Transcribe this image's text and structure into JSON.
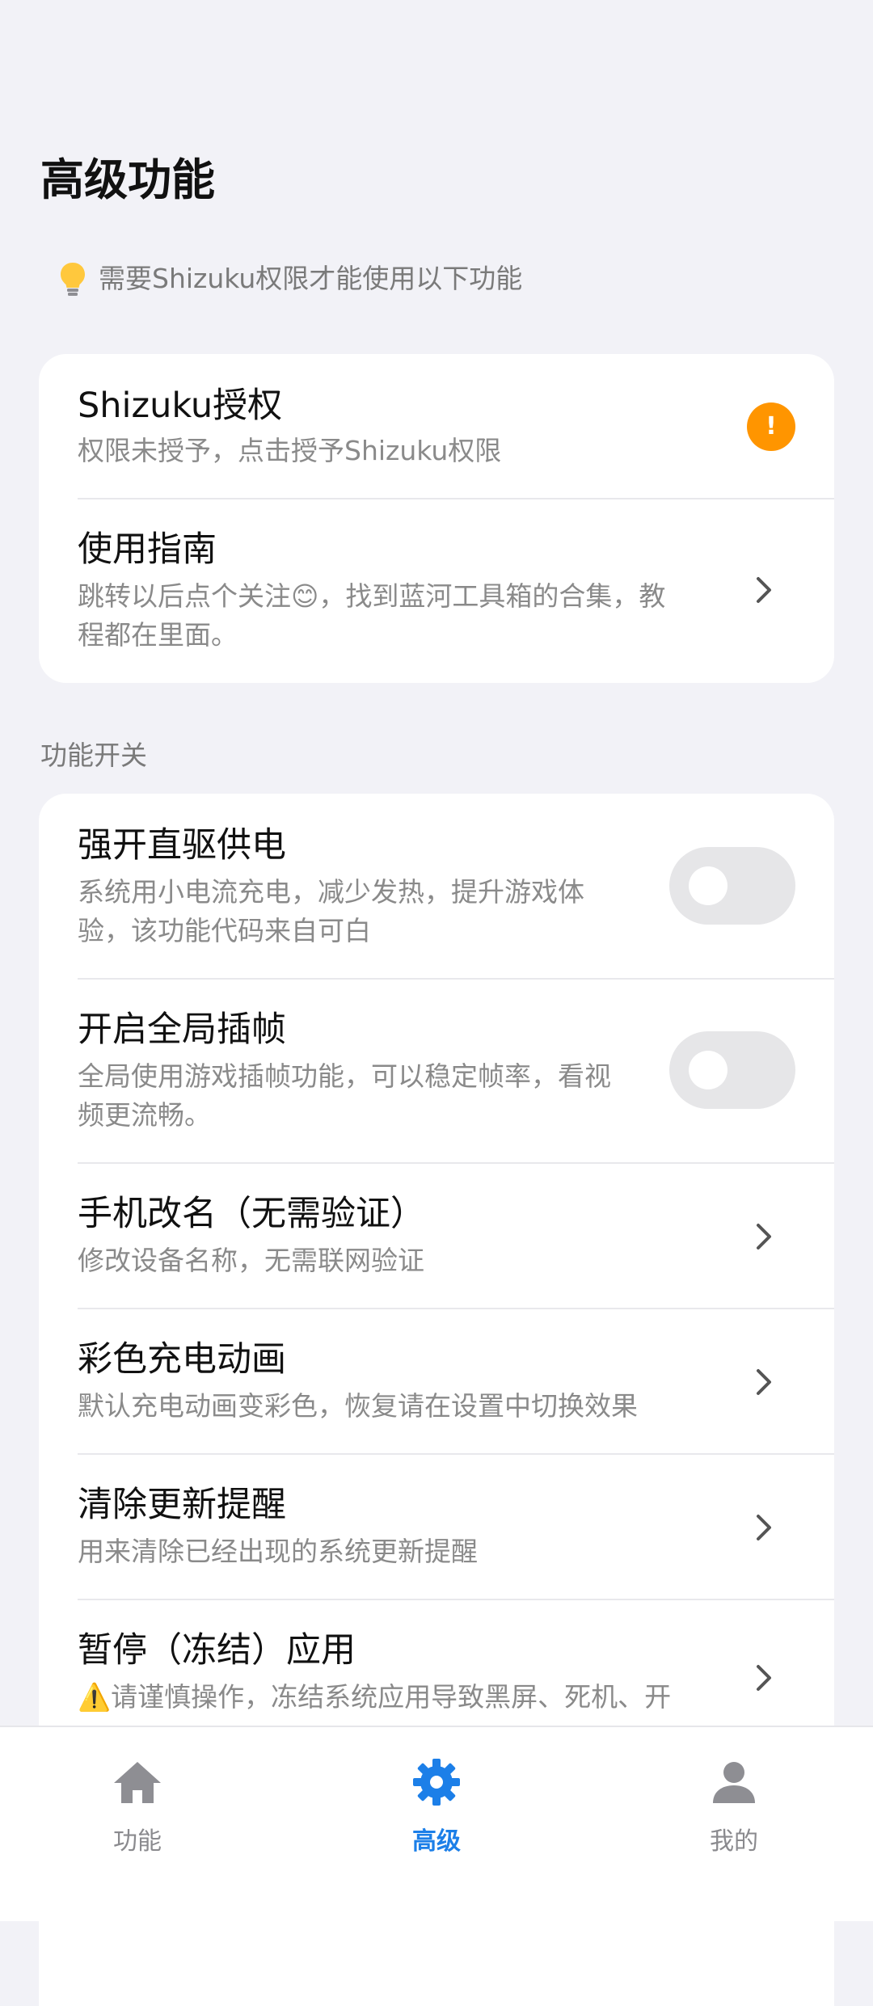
{
  "header": {
    "title": "高级功能"
  },
  "notice": {
    "text": "需要Shizuku权限才能使用以下功能"
  },
  "top_card": {
    "shizuku": {
      "title": "Shizuku授权",
      "subtitle": "权限未授予，点击授予Shizuku权限",
      "badge": "!"
    },
    "guide": {
      "title": "使用指南",
      "subtitle_line1": "跳转以后点个关注😊，找到蓝河工具箱的合集，教",
      "subtitle_line2": "程都在里面。"
    }
  },
  "section": {
    "label": "功能开关"
  },
  "features": {
    "direct_power": {
      "title": "强开直驱供电",
      "subtitle_line1": "系统用小电流充电，减少发热，提升游戏体",
      "subtitle_line2": "验，该功能代码来自可白",
      "enabled": false
    },
    "frame_interp": {
      "title": "开启全局插帧",
      "subtitle_line1": "全局使用游戏插帧功能，可以稳定帧率，看视",
      "subtitle_line2": "频更流畅。",
      "enabled": false
    },
    "rename": {
      "title": "手机改名（无需验证）",
      "subtitle": "修改设备名称，无需联网验证"
    },
    "charge_anim": {
      "title": "彩色充电动画",
      "subtitle": "默认充电动画变彩色，恢复请在设置中切换效果"
    },
    "clear_update": {
      "title": "清除更新提醒",
      "subtitle": "用来清除已经出现的系统更新提醒"
    },
    "freeze": {
      "title": "暂停（冻结）应用",
      "subtitle": "⚠️请谨慎操作，冻结系统应用导致黑屏、死机、开"
    }
  },
  "nav": {
    "items": [
      {
        "label": "功能",
        "icon": "home-icon"
      },
      {
        "label": "高级",
        "icon": "gear-icon"
      },
      {
        "label": "我的",
        "icon": "person-icon"
      }
    ],
    "active_index": 1
  },
  "colors": {
    "accent": "#1C7FE8",
    "warning": "#FF9500",
    "background": "#F2F2F7"
  }
}
